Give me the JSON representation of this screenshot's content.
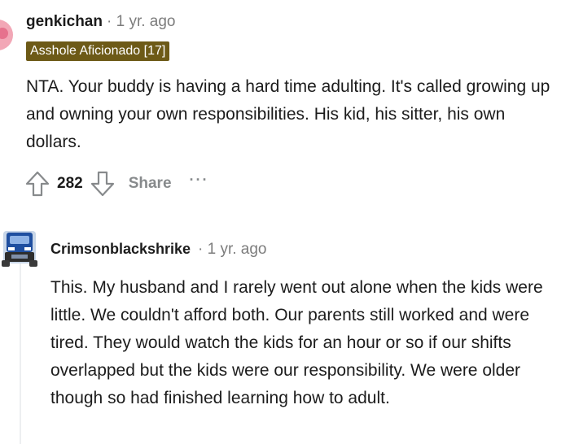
{
  "comment1": {
    "username": "genkichan",
    "separator": "·",
    "time": "1 yr. ago",
    "flair": "Asshole Aficionado [17]",
    "body": "NTA. Your buddy is having a hard time adulting. It's called growing up and owning your own responsibilities. His kid, his sitter, his own dollars.",
    "score": "282",
    "share_label": "Share",
    "more_label": "···"
  },
  "comment2": {
    "username": "Crimsonblackshrike",
    "separator": "·",
    "time": "1 yr. ago",
    "body": "This. My husband and I rarely went out alone when the kids were little. We couldn't afford both. Our parents still worked and were tired. They would watch the kids for an hour or so if our shifts overlapped but the kids were our responsibility. We were older though so had finished learning how to adult."
  },
  "icons": {
    "upvote": "upvote-arrow-icon",
    "downvote": "downvote-arrow-icon",
    "more": "more-options-icon"
  },
  "colors": {
    "flair_bg": "#6d5a17",
    "meta_gray": "#7c7c7c",
    "action_gray": "#878a8c"
  }
}
